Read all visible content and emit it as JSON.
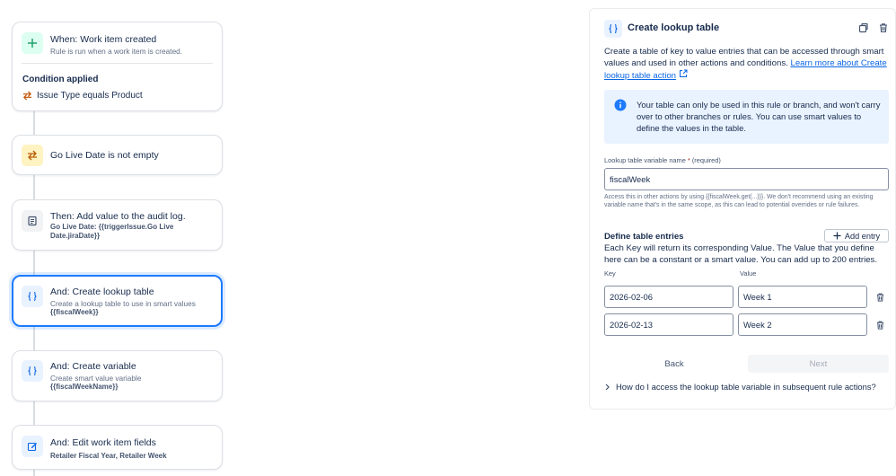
{
  "flow": {
    "trigger": {
      "title": "When: Work item created",
      "subtitle": "Rule is run when a work item is created.",
      "condition_title": "Condition applied",
      "condition_text": "Issue Type equals Product"
    },
    "condition": {
      "title": "Go Live Date is not empty"
    },
    "audit": {
      "title": "Then: Add value to the audit log.",
      "detail": "Go Live Date: {{triggerIssue.Go Live Date.jiraDate}}"
    },
    "lookup": {
      "title": "And: Create lookup table",
      "subtitle": "Create a lookup table to use in smart values",
      "detail": "{{fiscalWeek}}"
    },
    "variable": {
      "title": "And: Create variable",
      "subtitle": "Create smart value variable",
      "detail": "{{fiscalWeekName}}"
    },
    "edit": {
      "title": "And: Edit work item fields",
      "detail": "Retailer Fiscal Year, Retailer Week"
    }
  },
  "panel": {
    "title": "Create lookup table",
    "description": "Create a table of key to value entries that can be accessed through smart values and used in other actions and conditions.",
    "learn_more": "Learn more about Create lookup table action",
    "info": "Your table can only be used in this rule or branch, and won't carry over to other branches or rules. You can use smart values to define the values in the table.",
    "field_label": "Lookup table variable name",
    "field_required_mark": "*",
    "field_required_text": "(required)",
    "field_value": "fiscalWeek",
    "field_help": "Access this in other actions by using {{fiscalWeek.get(...)}}. We don't recommend using an existing variable name that's in the same scope, as this can lead to potential overrides or rule failures.",
    "section_title": "Define table entries",
    "add_entry": "Add entry",
    "section_desc": "Each Key will return its corresponding Value. The Value that you define here can be a constant or a smart value. You can add up to 200 entries.",
    "col_key": "Key",
    "col_value": "Value",
    "entries": [
      {
        "key": "2026-02-06",
        "value": "Week 1"
      },
      {
        "key": "2026-02-13",
        "value": "Week 2"
      }
    ],
    "back": "Back",
    "next": "Next",
    "faq": "How do I access the lookup table variable in subsequent rule actions?"
  },
  "colors": {
    "accent": "#1d7afc",
    "link": "#0c66e4",
    "info_bg": "#e9f2ff"
  }
}
